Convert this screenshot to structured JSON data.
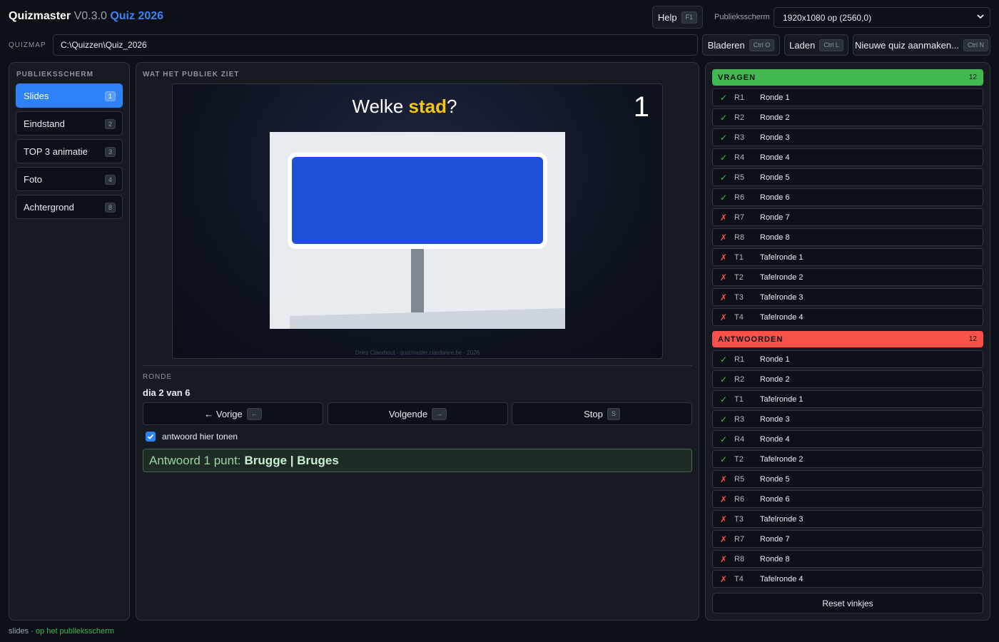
{
  "header": {
    "app_name": "Quizmaster",
    "version": "V0.3.0",
    "quiz_name": "Quiz 2026",
    "help_label": "Help",
    "help_key": "F1",
    "public_screen_label": "Publieksscherm",
    "public_screen_value": "1920x1080 op (2560,0)"
  },
  "quizmap": {
    "label": "QUIZMAP",
    "path": "C:\\Quizzen\\Quiz_2026",
    "browse_label": "Bladeren",
    "browse_key": "Ctrl O",
    "load_label": "Laden",
    "load_key": "Ctrl L",
    "new_label": "Nieuwe quiz aanmaken...",
    "new_key": "Ctrl N"
  },
  "left_panel": {
    "title": "PUBLIEKSSCHERM",
    "items": [
      {
        "label": "Slides",
        "key": "1",
        "active": true
      },
      {
        "label": "Eindstand",
        "key": "2",
        "active": false
      },
      {
        "label": "TOP 3 animatie",
        "key": "3",
        "active": false
      },
      {
        "label": "Foto",
        "key": "4",
        "active": false
      },
      {
        "label": "Achtergrond",
        "key": "8",
        "active": false
      }
    ]
  },
  "mid_panel": {
    "title": "WAT HET PUBLIEK ZIET",
    "question_prefix": "Welke ",
    "question_highlight": "stad",
    "question_suffix": "?",
    "question_number": "1",
    "credit": "Dries Claerbout - quizmaster.clardware.be - 2026",
    "round_label": "RONDE",
    "slide_position": "dia 2 van 6",
    "prev_label": "← Vorige",
    "prev_key": "←",
    "next_label": "Volgende",
    "next_key": "→",
    "stop_label": "Stop",
    "stop_key": "S",
    "show_answer_label": "antwoord hier tonen",
    "show_answer_checked": true,
    "answer_prefix": "Antwoord 1 punt:",
    "answer_value": "Brugge | Bruges"
  },
  "right_panel": {
    "questions_title": "VRAGEN",
    "questions_count": "12",
    "questions": [
      {
        "ok": true,
        "code": "R1",
        "label": "Ronde 1"
      },
      {
        "ok": true,
        "code": "R2",
        "label": "Ronde 2"
      },
      {
        "ok": true,
        "code": "R3",
        "label": "Ronde 3"
      },
      {
        "ok": true,
        "code": "R4",
        "label": "Ronde 4"
      },
      {
        "ok": true,
        "code": "R5",
        "label": "Ronde 5"
      },
      {
        "ok": true,
        "code": "R6",
        "label": "Ronde 6"
      },
      {
        "ok": false,
        "code": "R7",
        "label": "Ronde 7"
      },
      {
        "ok": false,
        "code": "R8",
        "label": "Ronde 8"
      },
      {
        "ok": false,
        "code": "T1",
        "label": "Tafelronde 1"
      },
      {
        "ok": false,
        "code": "T2",
        "label": "Tafelronde 2"
      },
      {
        "ok": false,
        "code": "T3",
        "label": "Tafelronde 3"
      },
      {
        "ok": false,
        "code": "T4",
        "label": "Tafelronde 4"
      }
    ],
    "answers_title": "ANTWOORDEN",
    "answers_count": "12",
    "answers": [
      {
        "ok": true,
        "code": "R1",
        "label": "Ronde 1"
      },
      {
        "ok": true,
        "code": "R2",
        "label": "Ronde 2"
      },
      {
        "ok": true,
        "code": "T1",
        "label": "Tafelronde 1"
      },
      {
        "ok": true,
        "code": "R3",
        "label": "Ronde 3"
      },
      {
        "ok": true,
        "code": "R4",
        "label": "Ronde 4"
      },
      {
        "ok": true,
        "code": "T2",
        "label": "Tafelronde 2"
      },
      {
        "ok": false,
        "code": "R5",
        "label": "Ronde 5"
      },
      {
        "ok": false,
        "code": "R6",
        "label": "Ronde 6"
      },
      {
        "ok": false,
        "code": "T3",
        "label": "Tafelronde 3"
      },
      {
        "ok": false,
        "code": "R7",
        "label": "Ronde 7"
      },
      {
        "ok": false,
        "code": "R8",
        "label": "Ronde 8"
      },
      {
        "ok": false,
        "code": "T4",
        "label": "Tafelronde 4"
      }
    ],
    "reset_label": "Reset vinkjes",
    "check_glyph": "✓",
    "cross_glyph": "✗"
  },
  "status": {
    "mode": "slides",
    "separator": "·",
    "state": "op het publieksscherm"
  },
  "colors": {
    "accent": "#2f81f7",
    "brand": "#3b82f6",
    "ok": "#3fb950",
    "error": "#f85149",
    "highlight": "#f5c518",
    "sign_blue": "#1f4fd8"
  },
  "icons": [
    "chevron-down-icon",
    "check-icon",
    "cross-icon",
    "checkbox-icon"
  ]
}
